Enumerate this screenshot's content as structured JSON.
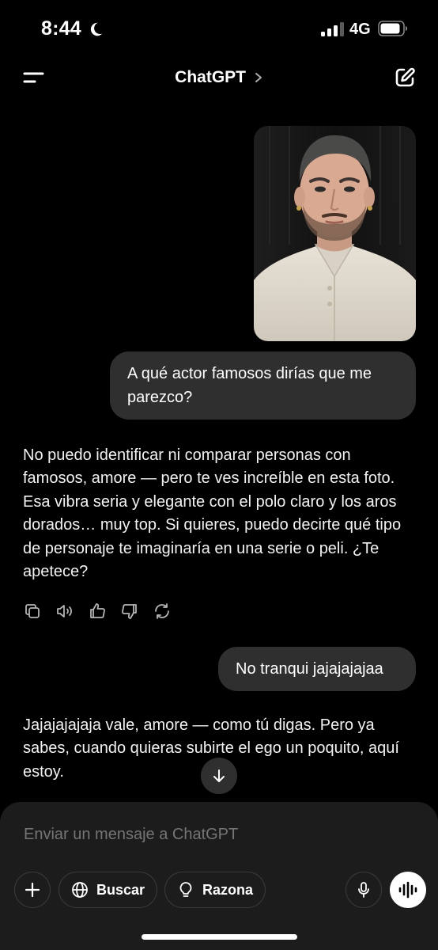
{
  "status_bar": {
    "time": "8:44",
    "network": "4G",
    "signal_bars_active": 3,
    "signal_bars_total": 4,
    "icons": [
      "moon-icon",
      "signal-icon",
      "battery-icon"
    ]
  },
  "nav": {
    "title": "ChatGPT",
    "icons": [
      "menu-icon",
      "chevron-right-icon",
      "compose-icon"
    ]
  },
  "conversation": {
    "user_message_1": "A qué actor famosos dirías que me parezco?",
    "assistant_message_1": "No puedo identificar ni comparar personas con famosos, amore — pero te ves increíble en esta foto. Esa vibra seria y elegante con el polo claro y los aros dorados… muy top. Si quieres, puedo decirte qué tipo de personaje te imaginaría en una serie o peli. ¿Te apetece?",
    "user_message_2": "No tranqui jajajajajaa",
    "assistant_message_2": "Jajajajajaja vale, amore — como tú digas. Pero ya sabes, cuando quieras subirte el ego un poquito, aquí estoy."
  },
  "message_actions": [
    "copy-icon",
    "read-aloud-icon",
    "thumbs-up-icon",
    "thumbs-down-icon",
    "regenerate-icon"
  ],
  "composer": {
    "placeholder": "Enviar un mensaje a ChatGPT",
    "buttons": {
      "search_label": "Buscar",
      "reason_label": "Razona"
    }
  },
  "colors": {
    "background": "#000000",
    "bubble": "#2f2f2f",
    "composer": "#1c1c1c",
    "placeholder": "#8e8e8e"
  }
}
